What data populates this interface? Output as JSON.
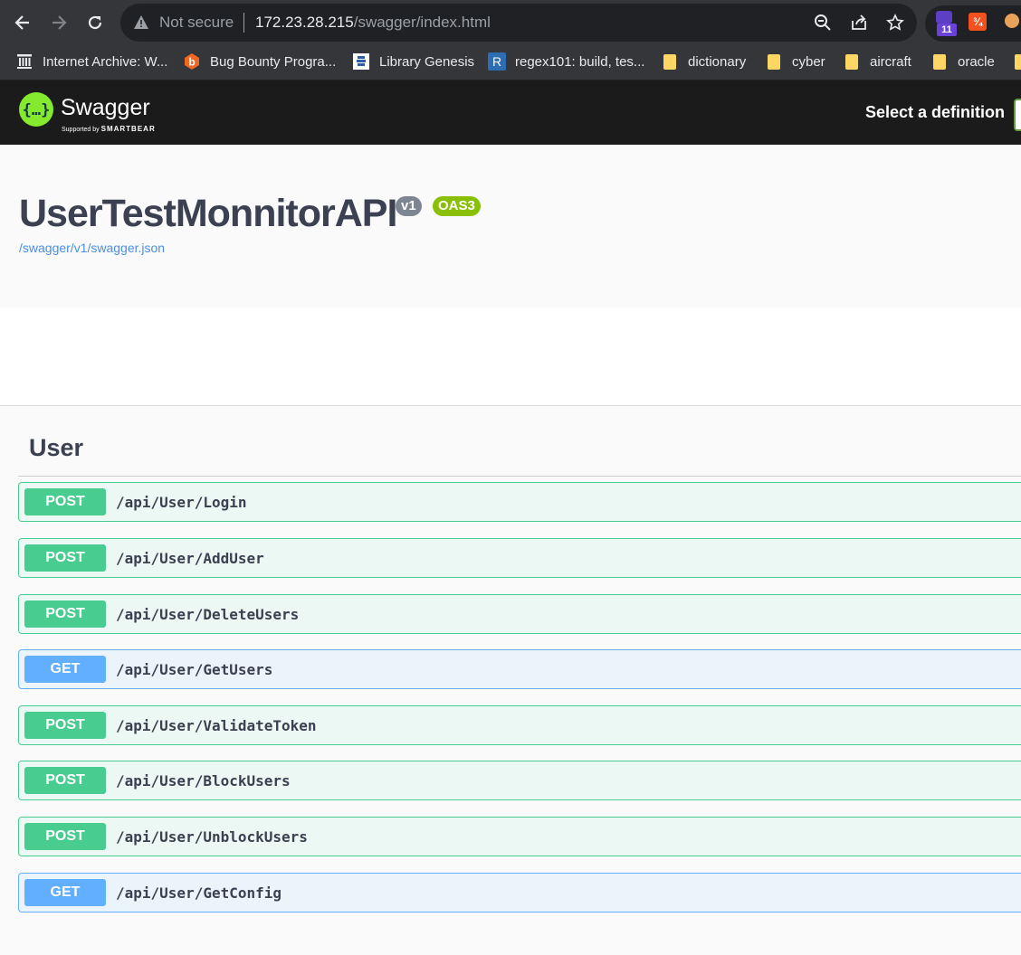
{
  "browser": {
    "not_secure_label": "Not secure",
    "url_host": "172.23.28.215",
    "url_path": "/swagger/index.html",
    "extension_badge": "11",
    "bookmarks": [
      {
        "label": "Internet Archive: W...",
        "icon": "archive-icon"
      },
      {
        "label": "Bug Bounty Progra...",
        "icon": "bugcrowd-icon"
      },
      {
        "label": "Library Genesis",
        "icon": "library-icon"
      },
      {
        "label": "regex101: build, tes...",
        "icon": "regex-icon",
        "icon_text": "R"
      },
      {
        "label": "dictionary",
        "icon": "folder-icon"
      },
      {
        "label": "cyber",
        "icon": "folder-icon"
      },
      {
        "label": "aircraft",
        "icon": "folder-icon"
      },
      {
        "label": "oracle",
        "icon": "folder-icon"
      }
    ]
  },
  "topbar": {
    "logo_text": "Swagger",
    "logo_sub_prefix": "Supported by",
    "logo_sub_brand": "SMARTBEAR",
    "select_definition_label": "Select a definition"
  },
  "info": {
    "title": "UserTestMonnitorAPI",
    "version": "v1",
    "oas": "OAS3",
    "spec_url": "/swagger/v1/swagger.json"
  },
  "section": {
    "title": "User",
    "operations": [
      {
        "method": "POST",
        "path": "/api/User/Login"
      },
      {
        "method": "POST",
        "path": "/api/User/AddUser"
      },
      {
        "method": "POST",
        "path": "/api/User/DeleteUsers"
      },
      {
        "method": "GET",
        "path": "/api/User/GetUsers"
      },
      {
        "method": "POST",
        "path": "/api/User/ValidateToken"
      },
      {
        "method": "POST",
        "path": "/api/User/BlockUsers"
      },
      {
        "method": "POST",
        "path": "/api/User/UnblockUsers"
      },
      {
        "method": "GET",
        "path": "/api/User/GetConfig"
      }
    ]
  },
  "colors": {
    "post": "#49cc90",
    "get": "#61affe",
    "topbar": "#1b1b1b",
    "swagger_green": "#85ea2d",
    "oas_badge": "#89bf04",
    "version_badge": "#7d8492"
  }
}
